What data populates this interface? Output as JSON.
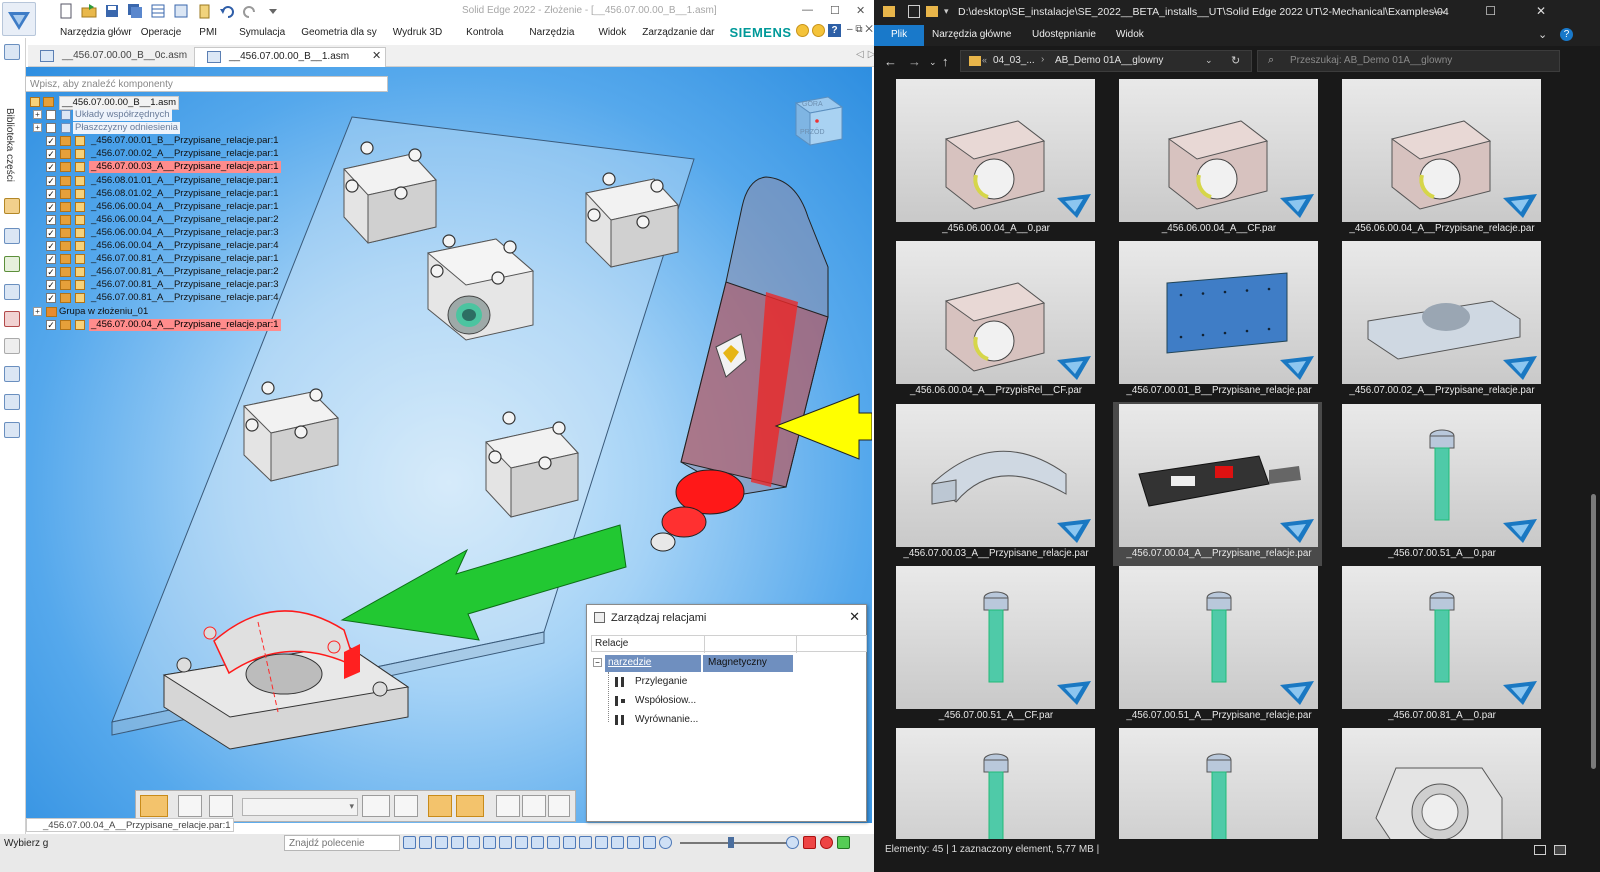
{
  "solid_edge": {
    "title": "Solid Edge 2022 - Złożenie - [__456.07.00.00_B__1.asm]",
    "ribbon_tabs": [
      "Narzędzia główr",
      "Operacje",
      "PMI",
      "Symulacja",
      "Geometria dla sy",
      "Wydruk 3D",
      "Kontrola",
      "Narzędzia",
      "Widok",
      "Zarządzanie dar"
    ],
    "brand": "SIEMENS",
    "doc_tabs": [
      "__456.07.00.00_B__0c.asm",
      "__456.07.00.00_B__1.asm"
    ],
    "side_label": "Biblioteka części",
    "search_placeholder": "Wpisz, aby znaleźć komponenty",
    "tree": [
      {
        "label": "__456.07.00.00_B__1.asm",
        "level": 0,
        "type": "root"
      },
      {
        "label": "Układy współrzędnych",
        "level": 1,
        "type": "group-dim"
      },
      {
        "label": "Płaszczyzny odniesienia",
        "level": 1,
        "type": "group-dim"
      },
      {
        "label": "_456.07.00.01_B__Przypisane_relacje.par:1",
        "level": 1,
        "type": "part"
      },
      {
        "label": "_456.07.00.02_A__Przypisane_relacje.par:1",
        "level": 1,
        "type": "part"
      },
      {
        "label": "_456.07.00.03_A__Przypisane_relacje.par:1",
        "level": 1,
        "type": "part-hl"
      },
      {
        "label": "_456.08.01.01_A__Przypisane_relacje.par:1",
        "level": 1,
        "type": "part"
      },
      {
        "label": "_456.08.01.02_A__Przypisane_relacje.par:1",
        "level": 1,
        "type": "part"
      },
      {
        "label": "_456.06.00.04_A__Przypisane_relacje.par:1",
        "level": 1,
        "type": "part"
      },
      {
        "label": "_456.06.00.04_A__Przypisane_relacje.par:2",
        "level": 1,
        "type": "part"
      },
      {
        "label": "_456.06.00.04_A__Przypisane_relacje.par:3",
        "level": 1,
        "type": "part"
      },
      {
        "label": "_456.06.00.04_A__Przypisane_relacje.par:4",
        "level": 1,
        "type": "part"
      },
      {
        "label": "_456.07.00.81_A__Przypisane_relacje.par:1",
        "level": 1,
        "type": "part"
      },
      {
        "label": "_456.07.00.81_A__Przypisane_relacje.par:2",
        "level": 1,
        "type": "part"
      },
      {
        "label": "_456.07.00.81_A__Przypisane_relacje.par:3",
        "level": 1,
        "type": "part"
      },
      {
        "label": "_456.07.00.81_A__Przypisane_relacje.par:4",
        "level": 1,
        "type": "part"
      },
      {
        "label": "Grupa w złożeniu_01",
        "level": 0,
        "type": "group"
      },
      {
        "label": "_456.07.00.04_A__Przypisane_relacje.par:1",
        "level": 1,
        "type": "part-hl"
      }
    ],
    "navcube": {
      "top": "GÓRA",
      "front": "PRZÓD"
    },
    "relations_dialog": {
      "title": "Zarządzaj relacjami",
      "col_header": "Relacje",
      "item_name": "narzedzie",
      "item_value": "Magnetyczny",
      "children": [
        "Przyleganie",
        "Współosiow...",
        "Wyrównanie..."
      ]
    },
    "status_doc": "_456.07.00.04_A__Przypisane_relacje.par:1",
    "status_left": "Wybierz g",
    "find_placeholder": "Znajdź polecenie",
    "colors": {
      "viewport": "#55a8ec",
      "highlight": "#ff8c8c",
      "brand": "#009999",
      "arrow_yellow": "#ffff00",
      "arrow_green": "#22c832"
    }
  },
  "explorer": {
    "path": "D:\\desktop\\SE_instalacje\\SE_2022__BETA_installs__UT\\Solid Edge 2022 UT\\2-Mechanical\\Examples\\04",
    "ribbon_tabs": [
      "Plik",
      "Narzędzia główne",
      "Udostępnianie",
      "Widok"
    ],
    "address_parts": [
      "04_03_...",
      "AB_Demo 01A__glowny"
    ],
    "search_placeholder": "Przeszukaj: AB_Demo 01A__glowny",
    "files": [
      {
        "name": "_456.06.00.04_A__0.par",
        "thumb": "bearing-block"
      },
      {
        "name": "_456.06.00.04_A__CF.par",
        "thumb": "bearing-block"
      },
      {
        "name": "_456.06.00.04_A__Przypisane_relacje.par",
        "thumb": "bearing-block"
      },
      {
        "name": "_456.06.00.04_A__PrzypisRel__CF.par",
        "thumb": "bearing-block"
      },
      {
        "name": "_456.07.00.01_B__Przypisane_relacje.par",
        "thumb": "plate"
      },
      {
        "name": "_456.07.00.02_A__Przypisane_relacje.par",
        "thumb": "clamp-base"
      },
      {
        "name": "_456.07.00.03_A__Przypisane_relacje.par",
        "thumb": "clamp-top"
      },
      {
        "name": "_456.07.00.04_A__Przypisane_relacje.par",
        "thumb": "grinder"
      },
      {
        "name": "_456.07.00.51_A__0.par",
        "thumb": "screw"
      },
      {
        "name": "_456.07.00.51_A__CF.par",
        "thumb": "screw"
      },
      {
        "name": "_456.07.00.51_A__Przypisane_relacje.par",
        "thumb": "screw"
      },
      {
        "name": "_456.07.00.81_A__0.par",
        "thumb": "screw"
      },
      {
        "name": "",
        "thumb": "screw"
      },
      {
        "name": "",
        "thumb": "screw"
      },
      {
        "name": "",
        "thumb": "nut-block"
      }
    ],
    "status": "Elementy: 45   |   1 zaznaczony element, 5,77 MB   |"
  }
}
